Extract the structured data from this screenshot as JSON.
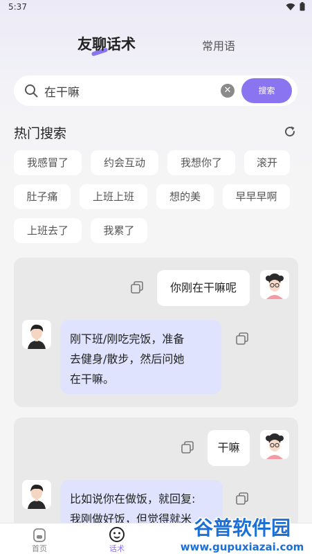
{
  "status_bar": {
    "time": "5:37"
  },
  "header": {
    "tab_active": "友聊话术",
    "tab_inactive": "常用语",
    "accent_color": "#8b74f0"
  },
  "search": {
    "value": "在干嘛",
    "button_label": "搜索"
  },
  "hot": {
    "title": "热门搜索",
    "tags": [
      "我感冒了",
      "约会互动",
      "我想你了",
      "滚开",
      "肚子痛",
      "上班上班",
      "想的美",
      "早早早啊",
      "上班去了",
      "我累了"
    ]
  },
  "cards": [
    {
      "question": "你刚在干嘛呢",
      "answer_lines": [
        "刚下班/刚吃完饭，准备",
        "去健身/散步，然后问她",
        "在干嘛。"
      ]
    },
    {
      "question": "干嘛",
      "answer_lines": [
        "比如说你在做饭，就回复:",
        "我刚做好饭，但觉得就米"
      ]
    }
  ],
  "bottom_nav": {
    "items": [
      {
        "label": "首页",
        "icon": "home-icon"
      },
      {
        "label": "话术",
        "icon": "chat-smile-icon",
        "active": true
      }
    ]
  },
  "watermark": {
    "title": "谷普软件园",
    "url": "www.gupuxiazai.com"
  }
}
